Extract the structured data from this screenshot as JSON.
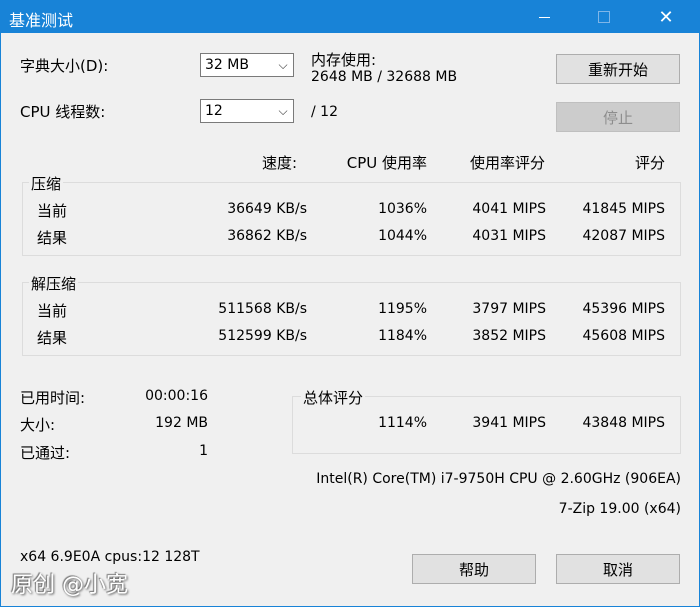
{
  "window": {
    "title": "基准测试",
    "minimize_icon": "minimize-icon",
    "maximize_icon": "maximize-icon",
    "close_icon": "close-icon",
    "close_glyph": "✕"
  },
  "dictionary": {
    "label": "字典大小(D):",
    "value": "32 MB"
  },
  "threads": {
    "label": "CPU 线程数:",
    "value": "12",
    "total": "/ 12"
  },
  "memory": {
    "label": "内存使用:",
    "value": "2648 MB / 32688 MB"
  },
  "buttons": {
    "restart": "重新开始",
    "stop": "停止",
    "help": "帮助",
    "cancel": "取消"
  },
  "columns": {
    "speed": "速度:",
    "cpu_usage": "CPU 使用率",
    "usage_rating": "使用率评分",
    "rating": "评分"
  },
  "compress": {
    "title": "压缩",
    "rows": [
      {
        "label": "当前",
        "speed": "36649 KB/s",
        "cpu": "1036%",
        "usage": "4041 MIPS",
        "rating": "41845 MIPS"
      },
      {
        "label": "结果",
        "speed": "36862 KB/s",
        "cpu": "1044%",
        "usage": "4031 MIPS",
        "rating": "42087 MIPS"
      }
    ]
  },
  "decompress": {
    "title": "解压缩",
    "rows": [
      {
        "label": "当前",
        "speed": "511568 KB/s",
        "cpu": "1195%",
        "usage": "3797 MIPS",
        "rating": "45396 MIPS"
      },
      {
        "label": "结果",
        "speed": "512599 KB/s",
        "cpu": "1184%",
        "usage": "3852 MIPS",
        "rating": "45608 MIPS"
      }
    ]
  },
  "stats": {
    "elapsed_label": "已用时间:",
    "elapsed_value": "00:00:16",
    "size_label": "大小:",
    "size_value": "192 MB",
    "passes_label": "已通过:",
    "passes_value": "1"
  },
  "total": {
    "title": "总体评分",
    "cpu": "1114%",
    "usage": "3941 MIPS",
    "rating": "43848 MIPS"
  },
  "cpu_info": "Intel(R) Core(TM) i7-9750H CPU @ 2.60GHz (906EA)",
  "version": "7-Zip 19.00 (x64)",
  "system_info": "x64 6.9E0A cpus:12 128T",
  "watermark": "原创 @小宽"
}
